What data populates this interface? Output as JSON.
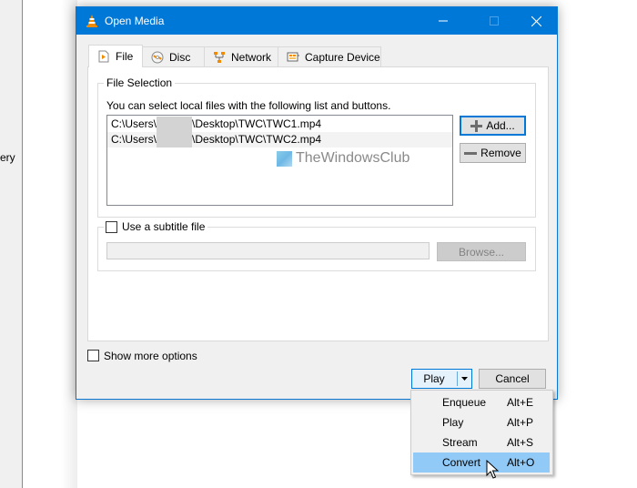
{
  "background": {
    "left_panel_text": "ery"
  },
  "dialog": {
    "title": "Open Media",
    "title_icon": "vlc-cone-icon",
    "controls": {
      "minimize": "minimize-icon",
      "maximize": "maximize-icon",
      "close": "close-icon"
    },
    "tabs": [
      {
        "label": "File",
        "icon": "file-icon",
        "active": true
      },
      {
        "label": "Disc",
        "icon": "disc-icon",
        "active": false
      },
      {
        "label": "Network",
        "icon": "network-icon",
        "active": false
      },
      {
        "label": "Capture Device",
        "icon": "capture-device-icon",
        "active": false
      }
    ],
    "file_selection": {
      "title": "File Selection",
      "hint": "You can select local files with the following list and buttons.",
      "files": [
        {
          "prefix": "C:\\Users\\",
          "suffix": "\\Desktop\\TWC\\TWC1.mp4"
        },
        {
          "prefix": "C:\\Users\\",
          "suffix": "\\Desktop\\TWC\\TWC2.mp4"
        }
      ],
      "add_label": "Add...",
      "remove_label": "Remove"
    },
    "watermark": "TheWindowsClub",
    "subtitle": {
      "label": "Use a subtitle file",
      "checked": false,
      "path_value": "",
      "browse_label": "Browse..."
    },
    "show_more_options": {
      "label": "Show more options",
      "checked": false
    },
    "play_label": "Play",
    "cancel_label": "Cancel"
  },
  "play_menu": {
    "items": [
      {
        "label": "Enqueue",
        "shortcut": "Alt+E",
        "highlighted": false
      },
      {
        "label": "Play",
        "shortcut": "Alt+P",
        "highlighted": false
      },
      {
        "label": "Stream",
        "shortcut": "Alt+S",
        "highlighted": false
      },
      {
        "label": "Convert",
        "shortcut": "Alt+O",
        "highlighted": true
      }
    ]
  },
  "colors": {
    "titlebar": "#0078d7",
    "menu_highlight": "#91c9f7",
    "vlc_orange": "#f28a00"
  }
}
